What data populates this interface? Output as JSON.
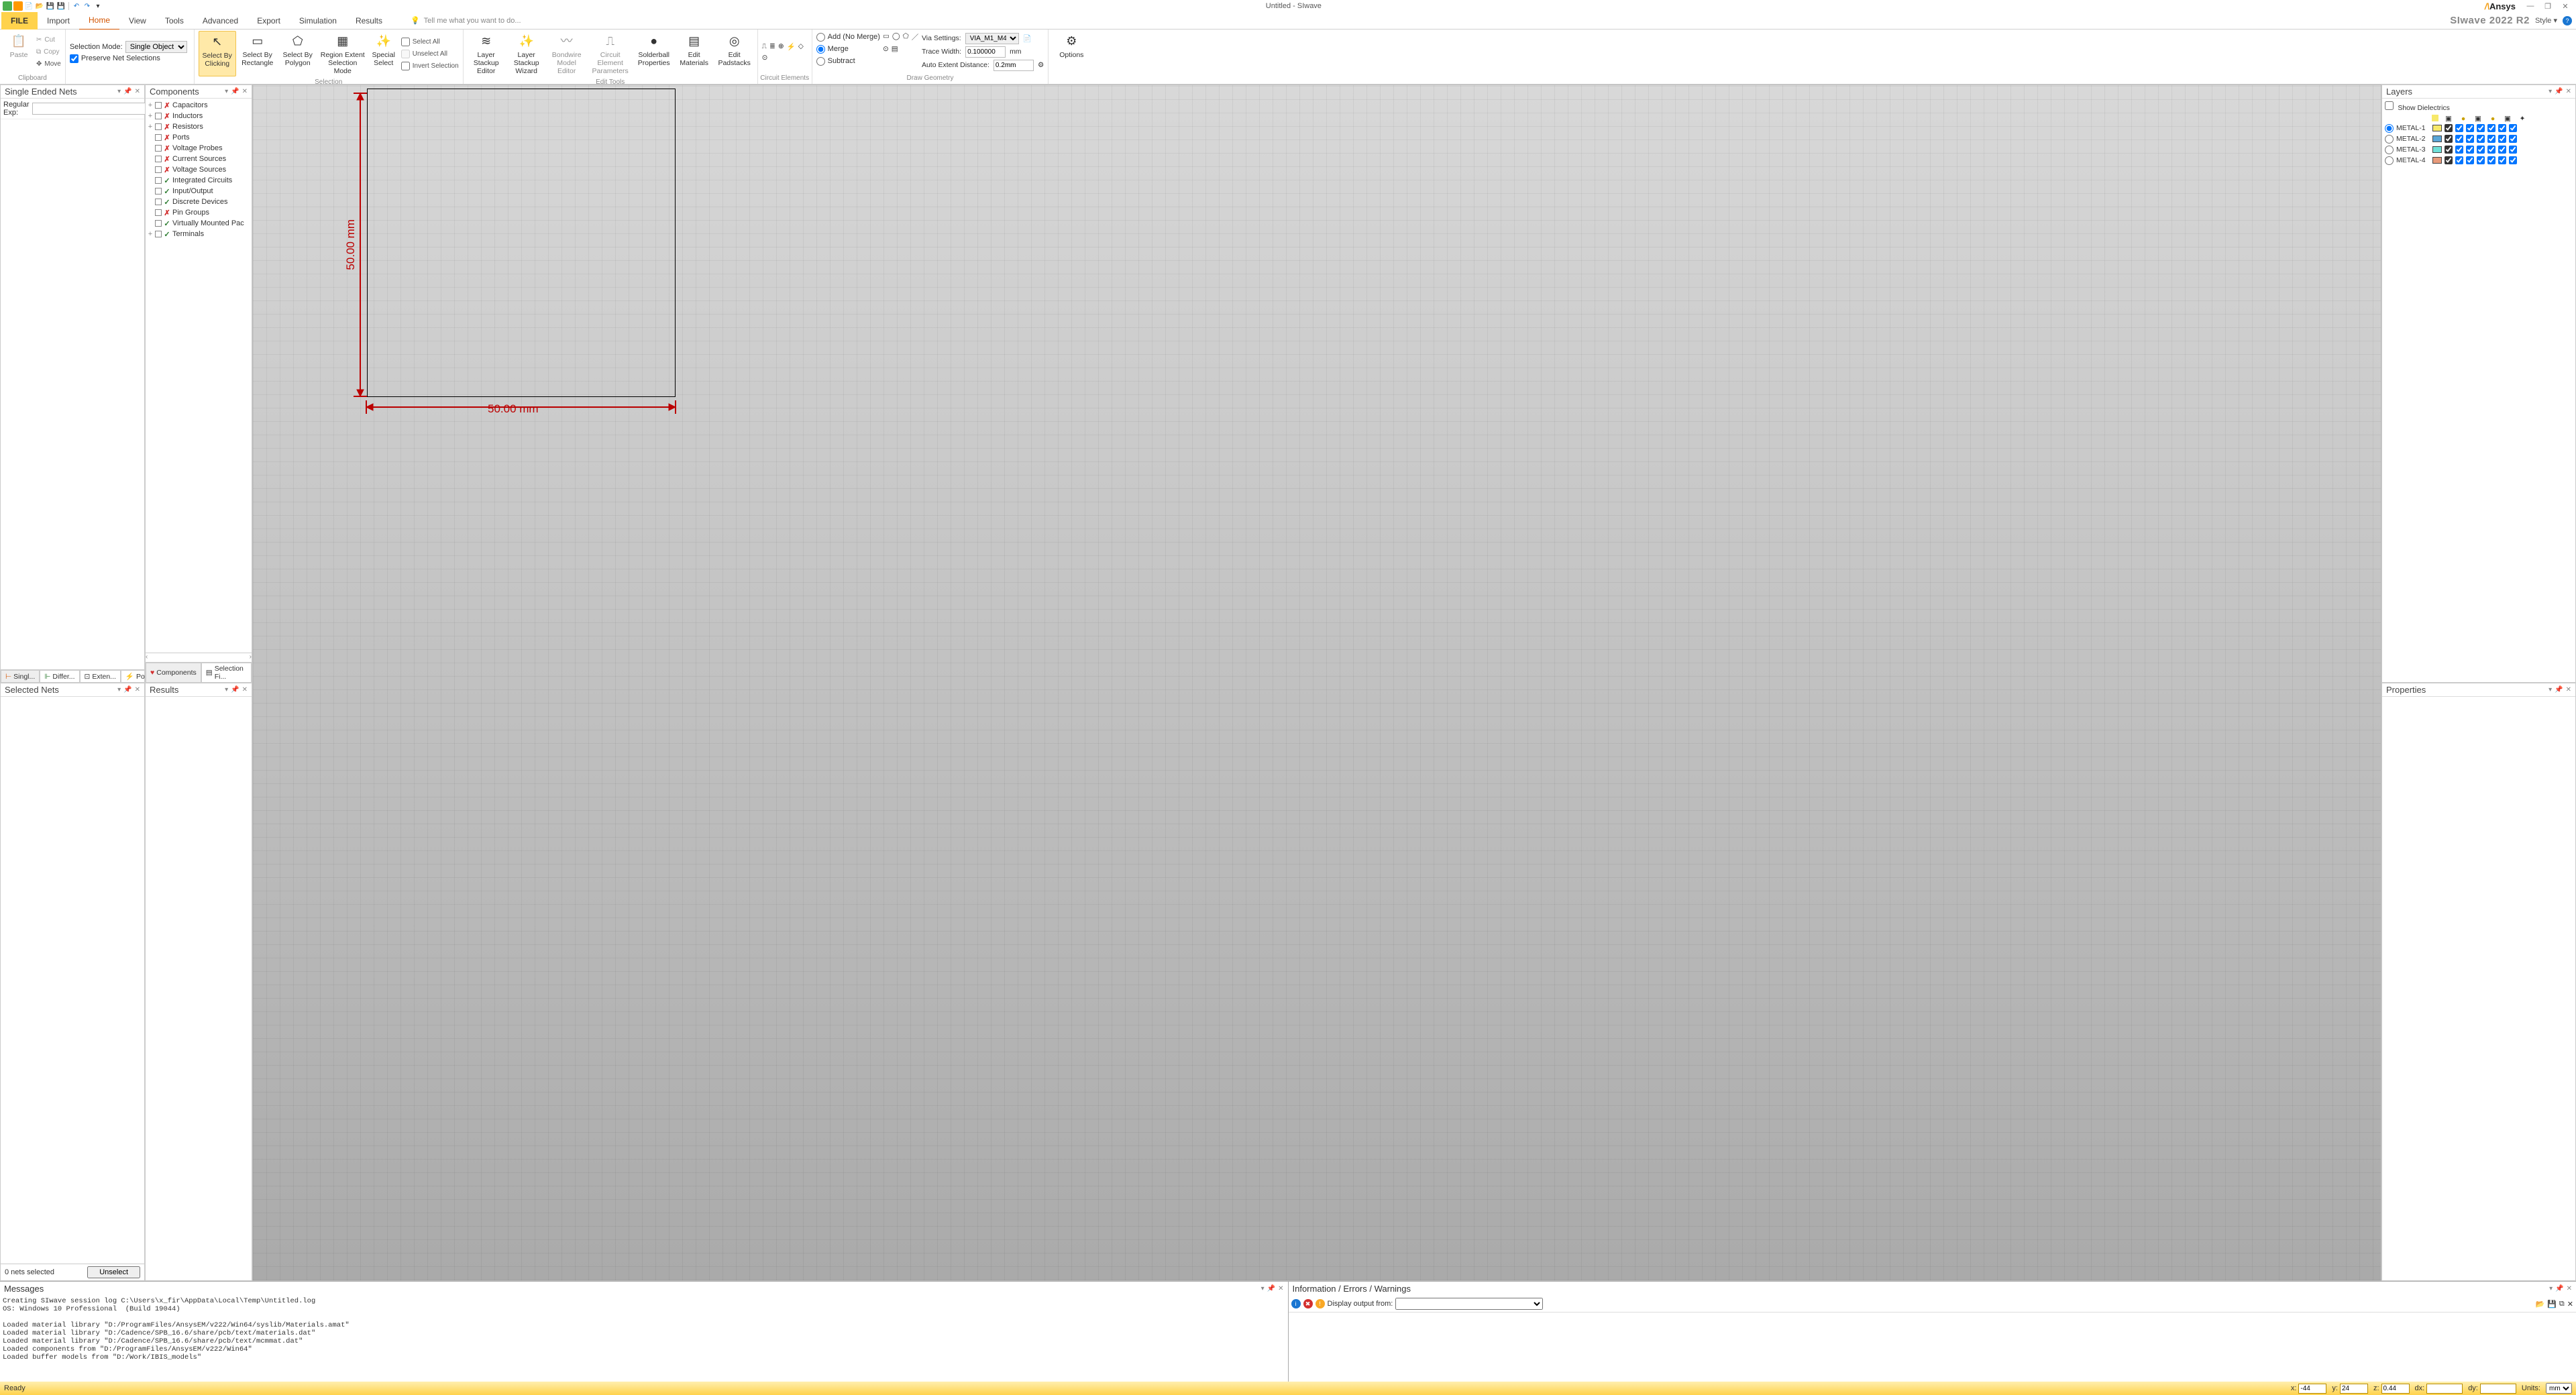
{
  "title": "Untitled - SIwave",
  "brand": "Ansys",
  "appname": "SIwave 2022 R2",
  "style_label": "Style",
  "tabs": {
    "file": "FILE",
    "items": [
      "Import",
      "Home",
      "View",
      "Tools",
      "Advanced",
      "Export",
      "Simulation",
      "Results"
    ],
    "active": "Home",
    "search_placeholder": "Tell me what you want to do..."
  },
  "ribbon": {
    "clipboard": {
      "paste": "Paste",
      "cut": "Cut",
      "copy": "Copy",
      "move": "Move",
      "label": "Clipboard"
    },
    "selection_mode": {
      "label": "Selection Mode:",
      "value": "Single Object",
      "preserve": "Preserve Net Selections"
    },
    "selection_group": {
      "buttons": [
        "Select By Clicking",
        "Select By Rectangle",
        "Select By Polygon",
        "Region Extent Selection Mode",
        "Special Select"
      ],
      "select_all": "Select All",
      "unselect_all": "Unselect All",
      "invert": "Invert Selection",
      "label": "Selection"
    },
    "edit_tools": {
      "buttons": [
        "Layer Stackup Editor",
        "Layer Stackup Wizard",
        "Bondwire Model Editor",
        "Circuit Element Parameters",
        "Solderball Properties",
        "Edit Materials",
        "Edit Padstacks"
      ],
      "label": "Edit Tools"
    },
    "circuit_elem_label": "Circuit Elements",
    "merge": {
      "add": "Add (No Merge)",
      "merge": "Merge",
      "subtract": "Subtract",
      "selected": "Merge"
    },
    "draw": {
      "via_label": "Via Settings:",
      "via_value": "VIA_M1_M4",
      "trace_label": "Trace Width:",
      "trace_value": "0.100000",
      "trace_unit": "mm",
      "extent_label": "Auto Extent Distance:",
      "extent_value": "0.2mm",
      "label": "Draw Geometry"
    },
    "options": "Options"
  },
  "panels": {
    "single_nets": "Single Ended Nets",
    "regexp": "Regular Exp:",
    "net_tabs": [
      "Singl...",
      "Differ...",
      "Exten...",
      "Powe..."
    ],
    "components": "Components",
    "comp_items": [
      {
        "exp": "+",
        "mark": "x",
        "label": "Capacitors"
      },
      {
        "exp": "+",
        "mark": "x",
        "label": "Inductors"
      },
      {
        "exp": "+",
        "mark": "x",
        "label": "Resistors"
      },
      {
        "exp": "",
        "mark": "x",
        "label": "Ports"
      },
      {
        "exp": "",
        "mark": "x",
        "label": "Voltage Probes"
      },
      {
        "exp": "",
        "mark": "x",
        "label": "Current Sources"
      },
      {
        "exp": "",
        "mark": "x",
        "label": "Voltage Sources"
      },
      {
        "exp": "",
        "mark": "v",
        "label": "Integrated Circuits"
      },
      {
        "exp": "",
        "mark": "v",
        "label": "Input/Output"
      },
      {
        "exp": "",
        "mark": "v",
        "label": "Discrete Devices"
      },
      {
        "exp": "",
        "mark": "x",
        "label": "Pin Groups"
      },
      {
        "exp": "",
        "mark": "v",
        "label": "Virtually Mounted Pac"
      },
      {
        "exp": "+",
        "mark": "v",
        "label": "Terminals"
      }
    ],
    "comp_tabs": [
      "Components",
      "Selection Fi..."
    ],
    "selected_nets": "Selected Nets",
    "sel_count": "0 nets selected",
    "unselect": "Unselect",
    "results": "Results",
    "layers": "Layers",
    "show_dielectrics": "Show Dielectrics",
    "layer_rows": [
      "METAL-1",
      "METAL-2",
      "METAL-3",
      "METAL-4"
    ],
    "layer_colors": [
      "#f7e96a",
      "#5aa6d8",
      "#6fe0d8",
      "#e89a7a"
    ],
    "properties": "Properties"
  },
  "canvas": {
    "dim_x": "50.00 mm",
    "dim_y": "50.00 mm"
  },
  "bottom": {
    "messages": "Messages",
    "message_text": "Creating SIwave session log C:\\Users\\x_fir\\AppData\\Local\\Temp\\Untitled.log\nOS: Windows 10 Professional  (Build 19044)\n\nLoaded material library \"D:/ProgramFiles/AnsysEM/v222/Win64/syslib/Materials.amat\"\nLoaded material library \"D:/Cadence/SPB_16.6/share/pcb/text/materials.dat\"\nLoaded material library \"D:/Cadence/SPB_16.6/share/pcb/text/mcmmat.dat\"\nLoaded components from \"D:/ProgramFiles/AnsysEM/v222/Win64\"\nLoaded buffer models from \"D:/Work/IBIS_models\"",
    "info_title": "Information / Errors / Warnings",
    "display_from": "Display output from:"
  },
  "status": {
    "ready": "Ready",
    "x": "-44",
    "y": "24",
    "z": "0.44",
    "dx": "",
    "dy": "",
    "units_label": "Units:",
    "units": "mm"
  }
}
